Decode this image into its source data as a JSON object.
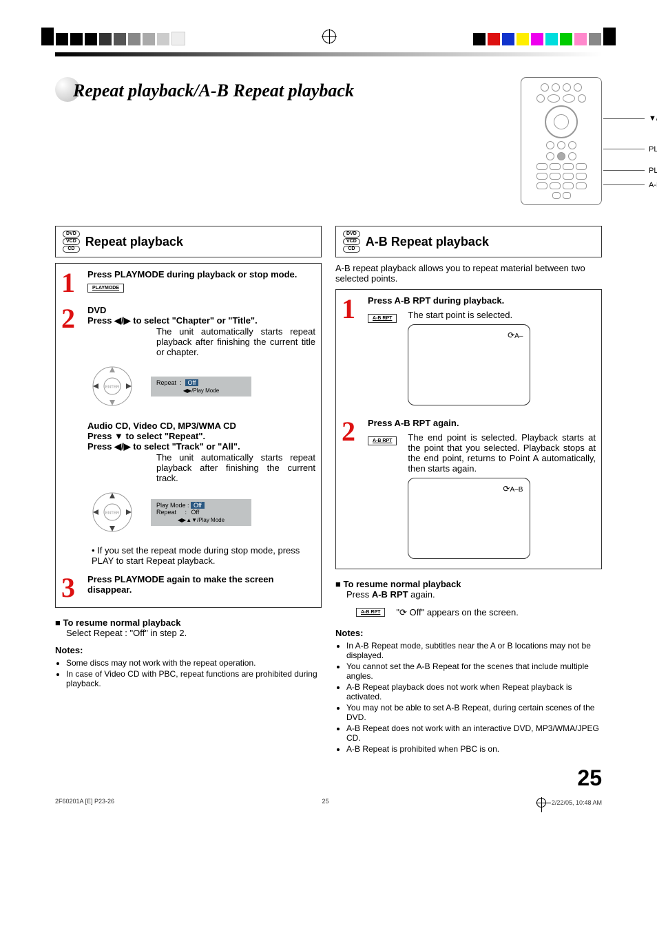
{
  "header": {
    "title": "Repeat playback/A-B Repeat playback",
    "remote_labels": {
      "arrows": "▼/◀/▶",
      "play": "PLAY",
      "playmode": "PLAYMODE",
      "abrpt": "A-B RPT"
    }
  },
  "left": {
    "section_title": "Repeat playback",
    "disc_labels": [
      "DVD",
      "VCD",
      "CD"
    ],
    "step1": {
      "title": "Press PLAYMODE during playback or stop mode.",
      "button": "PLAYMODE"
    },
    "step2": {
      "dvd_label": "DVD",
      "dvd_line": "Press ◀/▶ to select \"Chapter\" or \"Title\".",
      "dvd_desc": "The unit automatically starts repeat playback after finishing the current title or chapter.",
      "osd1": {
        "label": "Repeat",
        "value": "Off",
        "nav": "◀▶/Play Mode"
      },
      "cd_title": "Audio CD, Video CD, MP3/WMA CD",
      "cd_line1": "Press ▼ to select \"Repeat\".",
      "cd_line2": "Press ◀/▶ to select \"Track\" or \"All\".",
      "cd_desc": "The unit automatically starts repeat playback after finishing the current track.",
      "osd2": {
        "row1_label": "Play Mode",
        "row1_value": "Off",
        "row2_label": "Repeat",
        "row2_value": "Off",
        "nav": "◀▶▲▼/Play Mode"
      },
      "bullet": "If you set the repeat mode during stop mode, press PLAY to start Repeat playback.",
      "bullet_bold": "PLAY"
    },
    "step3": {
      "title": "Press PLAYMODE again to make the screen disappear."
    },
    "resume_title": "To resume normal playback",
    "resume_text": "Select Repeat : \"Off\" in step 2.",
    "notes_title": "Notes:",
    "notes": [
      "Some discs may not work with the repeat operation.",
      "In case of Video CD with PBC, repeat functions are prohibited during playback."
    ]
  },
  "right": {
    "section_title": "A-B Repeat playback",
    "disc_labels": [
      "DVD",
      "VCD",
      "CD"
    ],
    "intro": "A-B repeat playback allows you to repeat material between two selected points.",
    "step1": {
      "title": "Press A-B RPT during playback.",
      "button": "A-B RPT",
      "desc": "The start point is selected.",
      "tv": "A–"
    },
    "step2": {
      "title": "Press A-B RPT again.",
      "button": "A-B RPT",
      "desc": "The end point is selected. Playback starts at the point that you selected. Playback stops at the end point, returns to Point A automatically, then starts again.",
      "tv": "A–B"
    },
    "resume_title": "To resume normal playback",
    "resume_text_pre": "Press ",
    "resume_text_bold": "A-B RPT",
    "resume_text_post": " again.",
    "button": "A-B RPT",
    "off_text": "\" Off\" appears on the screen.",
    "notes_title": "Notes:",
    "notes": [
      "In A-B Repeat mode, subtitles near the A or B locations may not be displayed.",
      "You cannot set the A-B Repeat for the scenes that include multiple angles.",
      "A-B Repeat playback does not work when Repeat playback is activated.",
      "You may not be able to set A-B Repeat, during certain scenes of the DVD.",
      "A-B Repeat does not work with an interactive DVD, MP3/WMA/JPEG CD.",
      "A-B Repeat is prohibited when PBC is on."
    ]
  },
  "page_number": "25",
  "footer": {
    "left": "2F60201A [E] P23-26",
    "mid": "25",
    "right": "2/22/05, 10:48 AM"
  }
}
